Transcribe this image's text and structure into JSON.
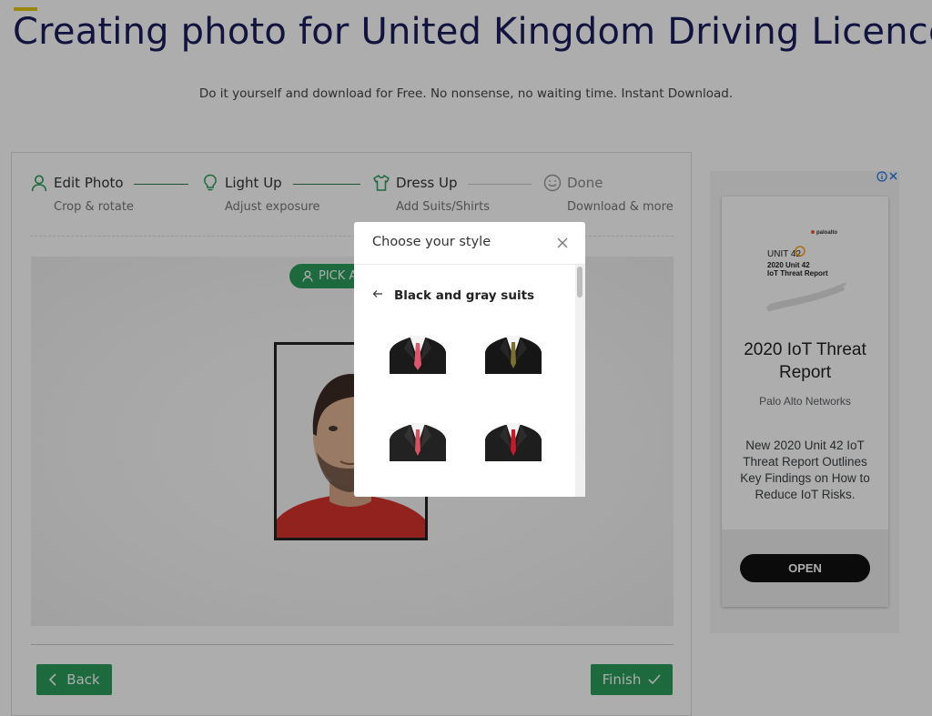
{
  "header": {
    "title": "Creating photo for United Kingdom Driving Licence",
    "subtitle": "Do it yourself and download for Free. No nonsense, no waiting time. Instant Download."
  },
  "steps": [
    {
      "title": "Edit Photo",
      "sub": "Crop & rotate",
      "icon": "user-icon"
    },
    {
      "title": "Light Up",
      "sub": "Adjust exposure",
      "icon": "lightbulb-icon"
    },
    {
      "title": "Dress Up",
      "sub": "Add Suits/Shirts",
      "icon": "shirt-icon"
    },
    {
      "title": "Done",
      "sub": "Download & more",
      "icon": "smile-icon"
    }
  ],
  "editor": {
    "pick_label": "PICK A",
    "back_label": "Back",
    "finish_label": "Finish"
  },
  "modal": {
    "title": "Choose your style",
    "category": "Black and gray suits",
    "suits": [
      "suit-1",
      "suit-2",
      "suit-3",
      "suit-4"
    ]
  },
  "ad": {
    "brand_logo_text": "paloalto",
    "logo_text_1": "UNIT 42",
    "logo_text_2": "2020 Unit 42",
    "logo_text_3": "IoT Threat Report",
    "title": "2020 IoT Threat Report",
    "brand": "Palo Alto Networks",
    "description": "New 2020 Unit 42 IoT Threat Report Outlines Key Findings on How to Reduce IoT Risks.",
    "cta": "OPEN"
  },
  "colors": {
    "accent_green": "#2a9d5c",
    "title_navy": "#1d1d5e",
    "accent_yellow": "#e8c916"
  }
}
